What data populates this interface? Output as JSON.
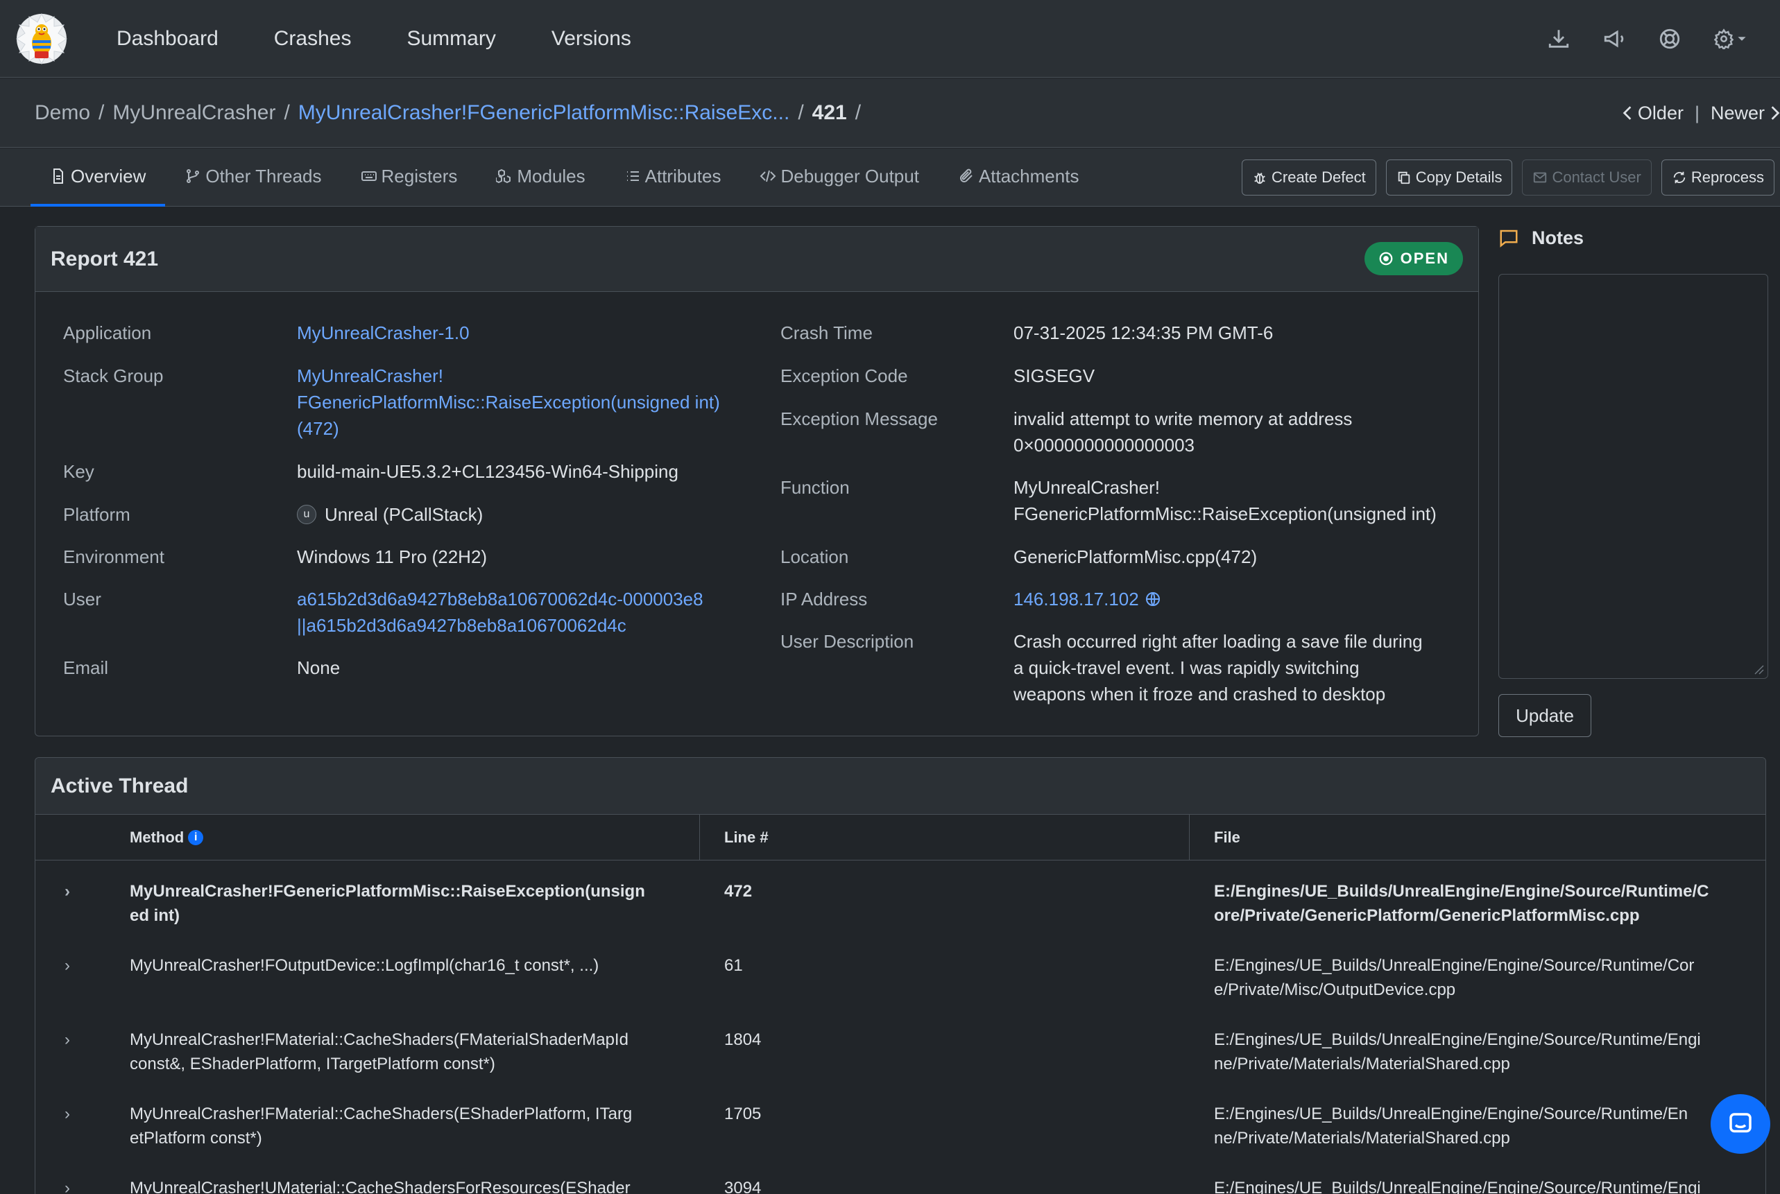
{
  "nav": {
    "items": [
      "Dashboard",
      "Crashes",
      "Summary",
      "Versions"
    ]
  },
  "breadcrumb": {
    "items": [
      "Demo",
      "MyUnrealCrasher",
      "MyUnrealCrasher!FGenericPlatformMisc::RaiseExc...",
      "421"
    ],
    "older": "Older",
    "newer": "Newer"
  },
  "tabs": [
    "Overview",
    "Other Threads",
    "Registers",
    "Modules",
    "Attributes",
    "Debugger Output",
    "Attachments"
  ],
  "actions": {
    "create_defect": "Create Defect",
    "copy_details": "Copy Details",
    "contact_user": "Contact User",
    "reprocess": "Reprocess"
  },
  "report": {
    "title": "Report 421",
    "status": "OPEN",
    "left": [
      {
        "label": "Application",
        "value": "MyUnrealCrasher-1.0"
      },
      {
        "label": "Stack Group",
        "value": "MyUnrealCrasher!\nFGenericPlatformMisc::RaiseException(unsigned int)\n(472)"
      },
      {
        "label": "Key",
        "value": "build-main-UE5.3.2+CL123456-Win64-Shipping"
      },
      {
        "label": "Platform",
        "value": "Unreal (PCallStack)"
      },
      {
        "label": "Environment",
        "value": "Windows 11 Pro (22H2)"
      },
      {
        "label": "User",
        "value": "a615b2d3d6a9427b8eb8a10670062d4c-000003e8\n||a615b2d3d6a9427b8eb8a10670062d4c"
      },
      {
        "label": "Email",
        "value": "None"
      }
    ],
    "right": [
      {
        "label": "Crash Time",
        "value": "07-31-2025 12:34:35 PM GMT-6"
      },
      {
        "label": "Exception Code",
        "value": "SIGSEGV"
      },
      {
        "label": "Exception Message",
        "value": "invalid attempt to write memory at address\n0×0000000000000003"
      },
      {
        "label": "Function",
        "value": "MyUnrealCrasher!\nFGenericPlatformMisc::RaiseException(unsigned int)"
      },
      {
        "label": "Location",
        "value": "GenericPlatformMisc.cpp(472)"
      },
      {
        "label": "IP Address",
        "value": "146.198.17.102"
      },
      {
        "label": "User Description",
        "value": "Crash occurred right after loading a save file during\na quick-travel event. I was rapidly switching\nweapons when it froze and crashed to desktop"
      }
    ]
  },
  "notes": {
    "title": "Notes",
    "update": "Update"
  },
  "thread": {
    "title": "Active Thread",
    "headers": {
      "method": "Method",
      "line": "Line #",
      "file": "File"
    },
    "rows": [
      {
        "method": "MyUnrealCrasher!FGenericPlatformMisc::RaiseException(unsign\ned int)",
        "line": "472",
        "file": "E:/Engines/UE_Builds/UnrealEngine/Engine/Source/Runtime/C\nore/Private/GenericPlatform/GenericPlatformMisc.cpp"
      },
      {
        "method": "MyUnrealCrasher!FOutputDevice::LogfImpl(char16_t const*, ...)",
        "line": "61",
        "file": "E:/Engines/UE_Builds/UnrealEngine/Engine/Source/Runtime/Cor\ne/Private/Misc/OutputDevice.cpp"
      },
      {
        "method": "MyUnrealCrasher!FMaterial::CacheShaders(FMaterialShaderMapId\nconst&, EShaderPlatform, ITargetPlatform const*)",
        "line": "1804",
        "file": "E:/Engines/UE_Builds/UnrealEngine/Engine/Source/Runtime/Engi\nne/Private/Materials/MaterialShared.cpp"
      },
      {
        "method": "MyUnrealCrasher!FMaterial::CacheShaders(EShaderPlatform, ITarg\netPlatform const*)",
        "line": "1705",
        "file": "E:/Engines/UE_Builds/UnrealEngine/Engine/Source/Runtime/En\nne/Private/Materials/MaterialShared.cpp"
      },
      {
        "method": "MyUnrealCrasher!UMaterial::CacheShadersForResources(EShader",
        "line": "3094",
        "file": "E:/Engines/UE_Builds/UnrealEngine/Engine/Source/Runtime/Engi"
      }
    ]
  }
}
